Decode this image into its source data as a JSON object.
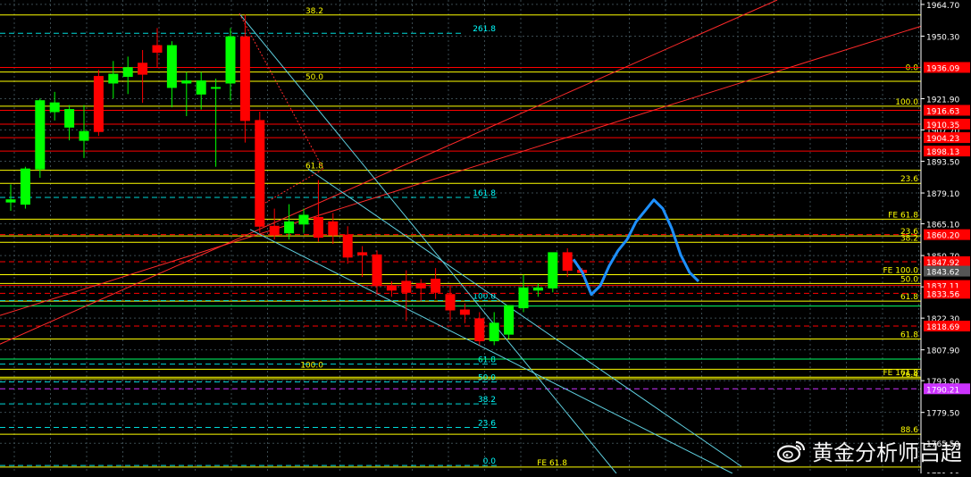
{
  "chart_data": {
    "type": "candlestick",
    "title": "",
    "xlabel": "",
    "ylabel": "",
    "ylim": [
      1751.8,
      1966.7
    ],
    "grid": true,
    "background": "#000000",
    "colors": {
      "up": "#00ff00",
      "down": "#ff0000",
      "grid": "#3a4a50",
      "axis_text": "#ffffff",
      "fib_yellow": "#ffff00",
      "fib_cyan": "#00ffff",
      "forecast": "#1e90ff",
      "purple": "#cc33ff",
      "trend_red": "#ff2a2a",
      "trend_cyan": "#5fd0e0"
    },
    "y_ticks": [
      "1964.70",
      "1950.30",
      "1921.90",
      "1907.70",
      "1893.50",
      "1879.10",
      "1865.10",
      "1850.70",
      "1836.50",
      "1822.30",
      "1807.90",
      "1793.90",
      "1779.50",
      "1765.50",
      "1751.10"
    ],
    "price_tags": [
      {
        "label": "1936.09",
        "value": 1936.09,
        "color": "#ff0000"
      },
      {
        "label": "1916.63",
        "value": 1916.63,
        "color": "#ff0000"
      },
      {
        "label": "1910.35",
        "value": 1910.35,
        "color": "#ff0000"
      },
      {
        "label": "1904.23",
        "value": 1904.23,
        "color": "#ff0000"
      },
      {
        "label": "1898.13",
        "value": 1898.13,
        "color": "#ff0000"
      },
      {
        "label": "1860.20",
        "value": 1860.2,
        "color": "#ff0000"
      },
      {
        "label": "1847.92",
        "value": 1847.92,
        "color": "#ff0000"
      },
      {
        "label": "1843.62",
        "value": 1843.62,
        "color": "#555555"
      },
      {
        "label": "1837.11",
        "value": 1837.11,
        "color": "#ff0000"
      },
      {
        "label": "1833.56",
        "value": 1833.56,
        "color": "#ff0000"
      },
      {
        "label": "1818.69",
        "value": 1818.69,
        "color": "#ff0000"
      },
      {
        "label": "1790.21",
        "value": 1790.21,
        "color": "#cc33ff"
      }
    ],
    "candles": [
      {
        "o": 1875.0,
        "h": 1883.0,
        "l": 1871.0,
        "c": 1876.0
      },
      {
        "o": 1874.0,
        "h": 1891.0,
        "l": 1872.0,
        "c": 1890.0
      },
      {
        "o": 1890.0,
        "h": 1922.0,
        "l": 1886.0,
        "c": 1921.0
      },
      {
        "o": 1916.0,
        "h": 1925.0,
        "l": 1912.0,
        "c": 1920.0
      },
      {
        "o": 1909.0,
        "h": 1919.0,
        "l": 1903.0,
        "c": 1917.0
      },
      {
        "o": 1903.0,
        "h": 1919.0,
        "l": 1895.0,
        "c": 1907.0
      },
      {
        "o": 1932.0,
        "h": 1935.0,
        "l": 1905.0,
        "c": 1907.0
      },
      {
        "o": 1929.0,
        "h": 1939.0,
        "l": 1922.0,
        "c": 1933.0
      },
      {
        "o": 1932.0,
        "h": 1941.0,
        "l": 1924.0,
        "c": 1936.0
      },
      {
        "o": 1938.0,
        "h": 1944.0,
        "l": 1920.0,
        "c": 1933.0
      },
      {
        "o": 1946.0,
        "h": 1954.0,
        "l": 1936.0,
        "c": 1943.0
      },
      {
        "o": 1927.0,
        "h": 1948.0,
        "l": 1918.0,
        "c": 1946.0
      },
      {
        "o": 1929.0,
        "h": 1934.0,
        "l": 1914.0,
        "c": 1930.0
      },
      {
        "o": 1924.0,
        "h": 1934.0,
        "l": 1917.0,
        "c": 1930.0
      },
      {
        "o": 1927.0,
        "h": 1931.0,
        "l": 1891.0,
        "c": 1927.0
      },
      {
        "o": 1929.0,
        "h": 1954.0,
        "l": 1921.0,
        "c": 1950.0
      },
      {
        "o": 1950.0,
        "h": 1960.0,
        "l": 1902.0,
        "c": 1912.0
      },
      {
        "o": 1912.0,
        "h": 1916.0,
        "l": 1861.0,
        "c": 1864.0
      },
      {
        "o": 1864.0,
        "h": 1872.0,
        "l": 1858.0,
        "c": 1860.0
      },
      {
        "o": 1861.0,
        "h": 1874.0,
        "l": 1858.0,
        "c": 1866.0
      },
      {
        "o": 1865.0,
        "h": 1872.0,
        "l": 1861.0,
        "c": 1869.0
      },
      {
        "o": 1868.0,
        "h": 1885.0,
        "l": 1857.0,
        "c": 1859.0
      },
      {
        "o": 1866.0,
        "h": 1870.0,
        "l": 1856.0,
        "c": 1860.0
      },
      {
        "o": 1860.0,
        "h": 1864.0,
        "l": 1847.0,
        "c": 1850.0
      },
      {
        "o": 1852.0,
        "h": 1855.0,
        "l": 1841.0,
        "c": 1851.0
      },
      {
        "o": 1851.0,
        "h": 1853.0,
        "l": 1833.0,
        "c": 1837.0
      },
      {
        "o": 1837.0,
        "h": 1839.0,
        "l": 1832.0,
        "c": 1835.0
      },
      {
        "o": 1839.0,
        "h": 1844.0,
        "l": 1821.0,
        "c": 1834.0
      },
      {
        "o": 1838.0,
        "h": 1840.0,
        "l": 1830.0,
        "c": 1836.0
      },
      {
        "o": 1840.0,
        "h": 1845.0,
        "l": 1831.0,
        "c": 1834.0
      },
      {
        "o": 1833.0,
        "h": 1837.0,
        "l": 1821.0,
        "c": 1826.0
      },
      {
        "o": 1826.0,
        "h": 1829.0,
        "l": 1820.0,
        "c": 1824.0
      },
      {
        "o": 1822.0,
        "h": 1825.0,
        "l": 1810.0,
        "c": 1812.0
      },
      {
        "o": 1812.0,
        "h": 1825.0,
        "l": 1810.0,
        "c": 1820.0
      },
      {
        "o": 1815.0,
        "h": 1828.0,
        "l": 1813.0,
        "c": 1828.0
      },
      {
        "o": 1827.0,
        "h": 1842.0,
        "l": 1825.0,
        "c": 1836.0
      },
      {
        "o": 1835.0,
        "h": 1838.0,
        "l": 1832.0,
        "c": 1836.0
      },
      {
        "o": 1836.0,
        "h": 1852.0,
        "l": 1834.0,
        "c": 1852.0
      },
      {
        "o": 1852.0,
        "h": 1854.0,
        "l": 1841.0,
        "c": 1844.0
      },
      {
        "o": 1844.0,
        "h": 1845.0,
        "l": 1841.0,
        "c": 1843.0
      }
    ],
    "forecast_path": [
      1849.0,
      1843.0,
      1833.0,
      1837.0,
      1846.0,
      1853.0,
      1858.0,
      1866.0,
      1871.0,
      1876.0,
      1872.0,
      1863.0,
      1851.0,
      1843.0,
      1839.0
    ],
    "fib_levels_yellow": [
      {
        "label": "38.2",
        "value": 1959.9
      },
      {
        "label": "50.0",
        "value": 1929.8
      },
      {
        "label": "61.8",
        "value": 1889.4
      },
      {
        "label": "100.0",
        "value": 1799.1
      },
      {
        "label": "0.0",
        "value": 1934.0
      },
      {
        "label": "100.0",
        "value": 1918.5
      },
      {
        "label": "23.6",
        "value": 1883.5
      },
      {
        "label": "23.6",
        "value": 1859.6
      },
      {
        "label": "38.2",
        "value": 1856.7
      },
      {
        "label": "50.0",
        "value": 1838.0
      },
      {
        "label": "61.8",
        "value": 1830.0
      },
      {
        "label": "61.8",
        "value": 1812.8
      },
      {
        "label": "76.4",
        "value": 1794.8
      },
      {
        "label": "88.6",
        "value": 1769.6
      }
    ],
    "fe_levels": [
      {
        "label": "FE 61.8",
        "value": 1867.2
      },
      {
        "label": "FE 100.0",
        "value": 1842.0
      },
      {
        "label": "FE 161.8",
        "value": 1795.5
      },
      {
        "label": "FE 61.8",
        "value": 1754.7
      }
    ],
    "fib_levels_cyan": [
      {
        "label": "261.8",
        "value": 1951.6
      },
      {
        "label": "161.8",
        "value": 1877.1
      },
      {
        "label": "100.0",
        "value": 1830.2
      },
      {
        "label": "61.8",
        "value": 1801.4
      },
      {
        "label": "50.0",
        "value": 1793.3
      },
      {
        "label": "38.2",
        "value": 1783.4
      },
      {
        "label": "23.6",
        "value": 1772.7
      },
      {
        "label": "0.0",
        "value": 1755.4
      }
    ]
  },
  "watermark": {
    "text": "黄金分析师吕超",
    "icon": "weibo-icon"
  }
}
